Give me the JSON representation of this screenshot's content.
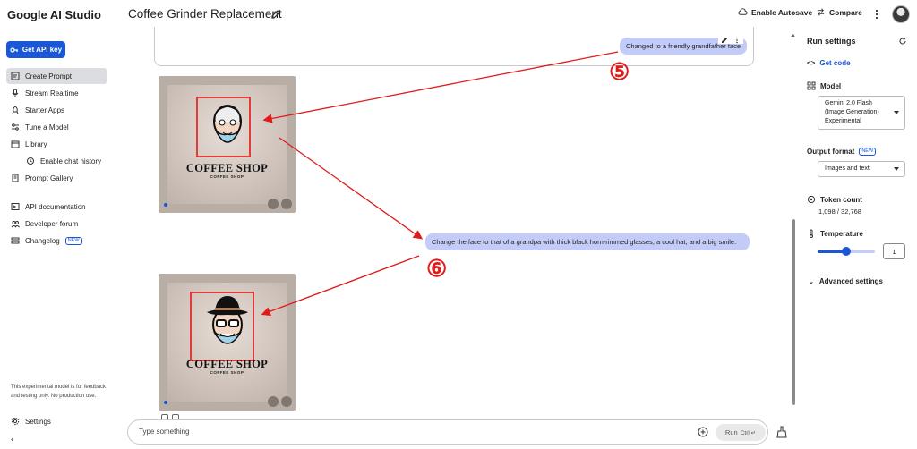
{
  "app": {
    "brand": "Google AI Studio",
    "doc_title": "Coffee Grinder Replacement"
  },
  "topbar": {
    "autosave": "Enable Autosave",
    "compare": "Compare"
  },
  "sidebar": {
    "api_key_button": "Get API key",
    "items": [
      {
        "label": "Create Prompt",
        "icon": "create-prompt-icon"
      },
      {
        "label": "Stream Realtime",
        "icon": "mic-icon"
      },
      {
        "label": "Starter Apps",
        "icon": "rocket-icon"
      },
      {
        "label": "Tune a Model",
        "icon": "tune-icon"
      },
      {
        "label": "Library",
        "icon": "library-icon"
      },
      {
        "label": "Enable chat history",
        "icon": "history-icon"
      },
      {
        "label": "Prompt Gallery",
        "icon": "gallery-icon"
      },
      {
        "label": "API documentation",
        "icon": "docs-icon"
      },
      {
        "label": "Developer forum",
        "icon": "forum-icon"
      },
      {
        "label": "Changelog",
        "icon": "changelog-icon",
        "badge": "NEW"
      }
    ],
    "notice": "This experimental model is for feedback and testing only. No production use.",
    "settings": "Settings"
  },
  "chat": {
    "bubble_1": "Changed to a friendly grandfather face",
    "bubble_2": "Change the face to that of a grandpa with thick black horn-rimmed glasses, a cool hat, and a big smile.",
    "image_1": {
      "title": "COFFEE SHOP",
      "subtitle": "COFFEE SHOP"
    },
    "image_2": {
      "title": "COFFEE SHOP",
      "subtitle": "COFFEE SHOP"
    },
    "marker_1": "⑤",
    "marker_2": "⑥",
    "annotation_color": "#e01b1b"
  },
  "prompt": {
    "placeholder": "Type something",
    "run": "Run",
    "shortcut": "Ctrl ↵"
  },
  "run_settings": {
    "title": "Run settings",
    "get_code": "Get code",
    "model_label": "Model",
    "model_value": "Gemini 2.0 Flash (Image Generation) Experimental",
    "output_label": "Output format",
    "output_badge": "NEW",
    "output_value": "Images and text",
    "token_label": "Token count",
    "token_value": "1,098 / 32,768",
    "temperature_label": "Temperature",
    "temperature_value": "1",
    "temperature_fraction": 0.5,
    "advanced": "Advanced settings"
  },
  "colors": {
    "accent": "#1a57d6",
    "bubble": "#c3ccf8",
    "active_nav": "#dcdde0"
  }
}
